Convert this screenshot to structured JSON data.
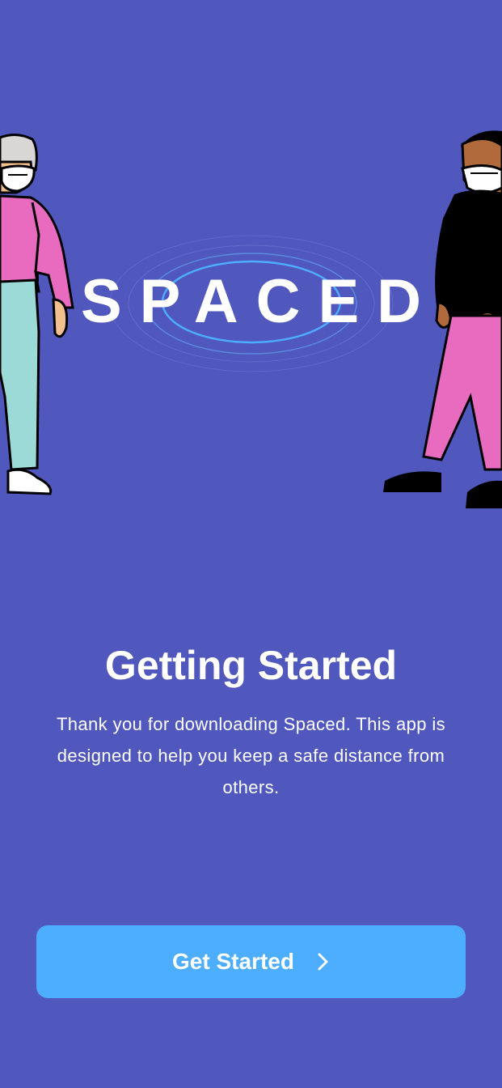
{
  "app": {
    "logo_text": "SPACED"
  },
  "onboarding": {
    "title": "Getting Started",
    "description": "Thank you for downloading Spaced. This app is designed to help you keep a safe distance from others.",
    "cta_label": "Get Started",
    "cta_icon": "chevron-right-icon"
  },
  "colors": {
    "background": "#5158BD",
    "button": "#4DAEFF",
    "text": "#FFFFFF",
    "ring": "#4DAEFF"
  }
}
